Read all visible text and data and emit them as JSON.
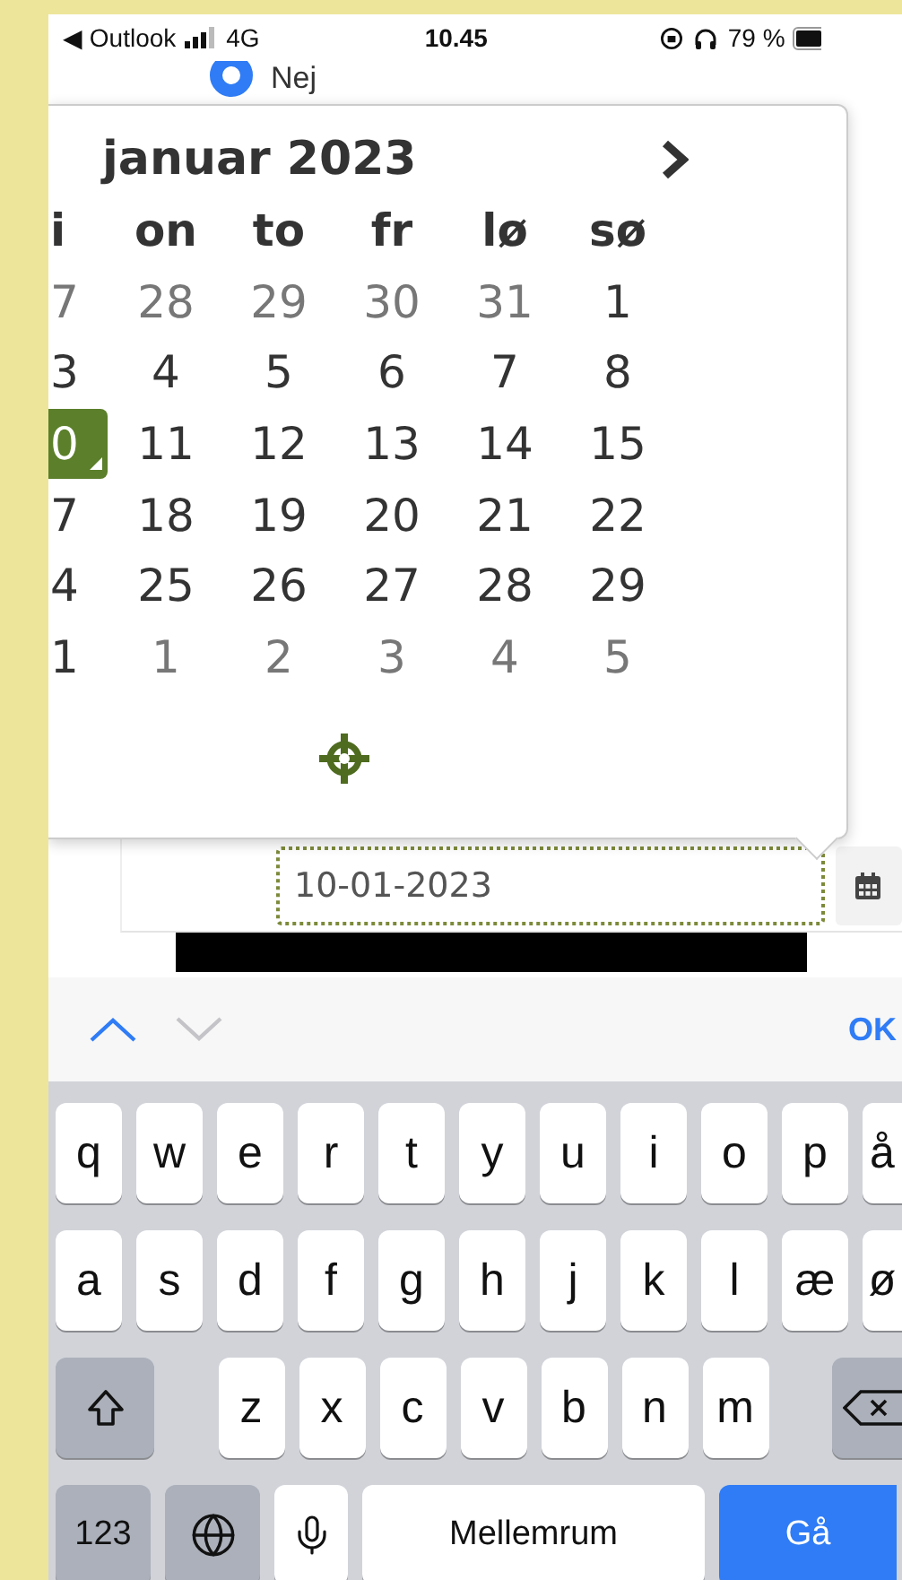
{
  "status_bar": {
    "back_app": "◀ Outlook",
    "network": "4G",
    "time": "10.45",
    "battery": "79 %"
  },
  "radio_option": {
    "label": "Nej",
    "selected": true
  },
  "datepicker": {
    "title": "januar 2023",
    "weekdays": [
      "i",
      "on",
      "to",
      "fr",
      "lø",
      "sø"
    ],
    "weeks": [
      [
        {
          "day": "7",
          "muted": true,
          "selected": false
        },
        {
          "day": "28",
          "muted": true,
          "selected": false
        },
        {
          "day": "29",
          "muted": true,
          "selected": false
        },
        {
          "day": "30",
          "muted": true,
          "selected": false
        },
        {
          "day": "31",
          "muted": true,
          "selected": false
        },
        {
          "day": "1",
          "muted": false,
          "selected": false
        }
      ],
      [
        {
          "day": "3",
          "muted": false,
          "selected": false
        },
        {
          "day": "4",
          "muted": false,
          "selected": false
        },
        {
          "day": "5",
          "muted": false,
          "selected": false
        },
        {
          "day": "6",
          "muted": false,
          "selected": false
        },
        {
          "day": "7",
          "muted": false,
          "selected": false
        },
        {
          "day": "8",
          "muted": false,
          "selected": false
        }
      ],
      [
        {
          "day": "0",
          "muted": false,
          "selected": true
        },
        {
          "day": "11",
          "muted": false,
          "selected": false
        },
        {
          "day": "12",
          "muted": false,
          "selected": false
        },
        {
          "day": "13",
          "muted": false,
          "selected": false
        },
        {
          "day": "14",
          "muted": false,
          "selected": false
        },
        {
          "day": "15",
          "muted": false,
          "selected": false
        }
      ],
      [
        {
          "day": "7",
          "muted": false,
          "selected": false
        },
        {
          "day": "18",
          "muted": false,
          "selected": false
        },
        {
          "day": "19",
          "muted": false,
          "selected": false
        },
        {
          "day": "20",
          "muted": false,
          "selected": false
        },
        {
          "day": "21",
          "muted": false,
          "selected": false
        },
        {
          "day": "22",
          "muted": false,
          "selected": false
        }
      ],
      [
        {
          "day": "4",
          "muted": false,
          "selected": false
        },
        {
          "day": "25",
          "muted": false,
          "selected": false
        },
        {
          "day": "26",
          "muted": false,
          "selected": false
        },
        {
          "day": "27",
          "muted": false,
          "selected": false
        },
        {
          "day": "28",
          "muted": false,
          "selected": false
        },
        {
          "day": "29",
          "muted": false,
          "selected": false
        }
      ],
      [
        {
          "day": "1",
          "muted": false,
          "selected": false
        },
        {
          "day": "1",
          "muted": true,
          "selected": false
        },
        {
          "day": "2",
          "muted": true,
          "selected": false
        },
        {
          "day": "3",
          "muted": true,
          "selected": false
        },
        {
          "day": "4",
          "muted": true,
          "selected": false
        },
        {
          "day": "5",
          "muted": true,
          "selected": false
        }
      ]
    ]
  },
  "date_field": {
    "value": "10-01-2023"
  },
  "keyboard": {
    "accessory": {
      "previous_enabled": true,
      "next_enabled": false,
      "done": "OK"
    },
    "rows": [
      {
        "keys": [
          {
            "kind": "letter",
            "label": "q"
          },
          {
            "kind": "letter",
            "label": "w"
          },
          {
            "kind": "letter",
            "label": "e"
          },
          {
            "kind": "letter",
            "label": "r"
          },
          {
            "kind": "letter",
            "label": "t"
          },
          {
            "kind": "letter",
            "label": "y"
          },
          {
            "kind": "letter",
            "label": "u"
          },
          {
            "kind": "letter",
            "label": "i"
          },
          {
            "kind": "letter",
            "label": "o"
          },
          {
            "kind": "letter",
            "label": "p"
          },
          {
            "kind": "edge",
            "label": "å"
          }
        ]
      },
      {
        "keys": [
          {
            "kind": "letter",
            "label": "a"
          },
          {
            "kind": "letter",
            "label": "s"
          },
          {
            "kind": "letter",
            "label": "d"
          },
          {
            "kind": "letter",
            "label": "f"
          },
          {
            "kind": "letter",
            "label": "g"
          },
          {
            "kind": "letter",
            "label": "h"
          },
          {
            "kind": "letter",
            "label": "j"
          },
          {
            "kind": "letter",
            "label": "k"
          },
          {
            "kind": "letter",
            "label": "l"
          },
          {
            "kind": "letter",
            "label": "æ"
          },
          {
            "kind": "edge",
            "label": "ø"
          }
        ]
      },
      {
        "keys": [
          {
            "kind": "shift"
          },
          {
            "kind": "letter",
            "label": "z"
          },
          {
            "kind": "letter",
            "label": "x"
          },
          {
            "kind": "letter",
            "label": "c"
          },
          {
            "kind": "letter",
            "label": "v"
          },
          {
            "kind": "letter",
            "label": "b"
          },
          {
            "kind": "letter",
            "label": "n"
          },
          {
            "kind": "letter",
            "label": "m"
          },
          {
            "kind": "backspace"
          }
        ]
      },
      {
        "keys": [
          {
            "kind": "numbers",
            "label": "123"
          },
          {
            "kind": "globe"
          },
          {
            "kind": "mic"
          },
          {
            "kind": "space",
            "label": "Mellemrum"
          },
          {
            "kind": "go",
            "label": "Gå"
          }
        ]
      }
    ]
  }
}
